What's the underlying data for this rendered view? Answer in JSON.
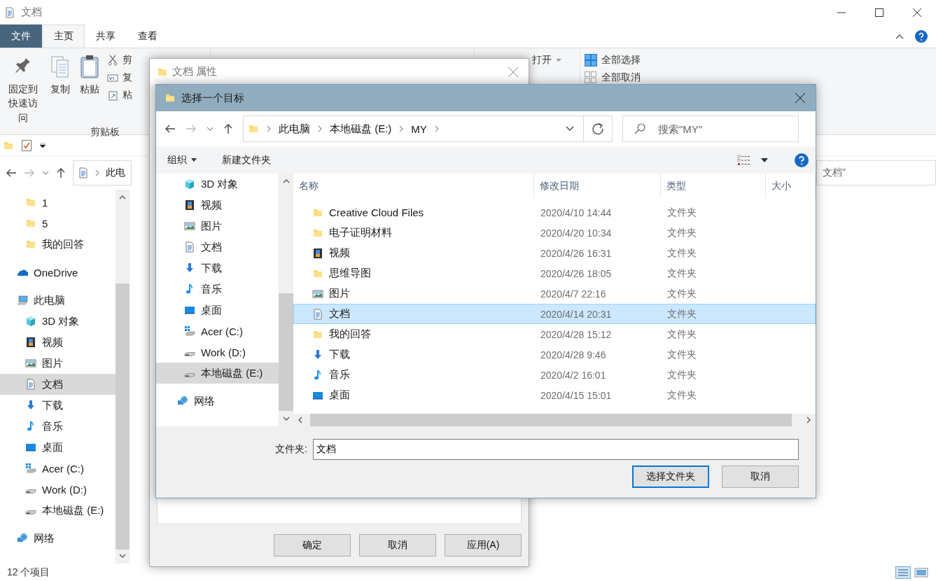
{
  "main_window": {
    "title": "文档",
    "ribbon_tabs": [
      {
        "label": "文件",
        "kind": "file"
      },
      {
        "label": "主页",
        "selected": true,
        "kind": "tab"
      },
      {
        "label": "共享",
        "selected": false,
        "kind": "tab"
      },
      {
        "label": "查看",
        "selected": false,
        "kind": "tab"
      }
    ],
    "clipboard_group": {
      "large_buttons": [
        {
          "label": "固定到快速访问",
          "kind": "pin"
        },
        {
          "label": "复制",
          "kind": "copy"
        },
        {
          "label": "粘贴",
          "kind": "paste"
        }
      ],
      "small_buttons": [
        {
          "label": "剪",
          "kind": "cut"
        },
        {
          "label": "复",
          "kind": "copypath"
        },
        {
          "label": "粘",
          "kind": "shortcut"
        }
      ],
      "label": "剪贴板"
    },
    "open_group": [
      {
        "label": "打开",
        "dropdown": true
      }
    ],
    "select_group": [
      {
        "label": "全部选择",
        "kind": "all"
      },
      {
        "label": "全部取消",
        "kind": "none"
      }
    ],
    "address_path": [
      "此电"
    ],
    "search_text": "文档\"",
    "nav_pane": {
      "quick_access_items": [
        {
          "label": "1",
          "kind": "folder",
          "selected": false
        },
        {
          "label": "5",
          "kind": "folder",
          "selected": false
        },
        {
          "label": "我的回答",
          "kind": "folder",
          "selected": false
        }
      ],
      "tree": [
        {
          "label": "OneDrive",
          "kind": "onedrive",
          "selected": false
        },
        {
          "label": "此电脑",
          "kind": "pc",
          "selected": false,
          "children": [
            {
              "label": "3D 对象",
              "kind": "cube",
              "selected": false
            },
            {
              "label": "视频",
              "kind": "video",
              "selected": false
            },
            {
              "label": "图片",
              "kind": "picture",
              "selected": false
            },
            {
              "label": "文档",
              "kind": "doc",
              "selected": true
            },
            {
              "label": "下载",
              "kind": "download",
              "selected": false
            },
            {
              "label": "音乐",
              "kind": "music",
              "selected": false
            },
            {
              "label": "桌面",
              "kind": "desktop",
              "selected": false
            },
            {
              "label": "Acer (C:)",
              "kind": "drive-win",
              "selected": false
            },
            {
              "label": "Work (D:)",
              "kind": "drive",
              "selected": false
            },
            {
              "label": "本地磁盘 (E:)",
              "kind": "drive",
              "selected": false
            }
          ]
        },
        {
          "label": "网络",
          "kind": "network",
          "selected": false
        }
      ]
    },
    "status_bar": "12 个项目"
  },
  "properties_dialog": {
    "title": "文档 属性",
    "buttons": [
      "确定",
      "取消",
      "应用(A)"
    ]
  },
  "select_dialog": {
    "title": "选择一个目标",
    "breadcrumbs": [
      "此电脑",
      "本地磁盘 (E:)",
      "MY"
    ],
    "search_placeholder": "搜索\"MY\"",
    "toolbar": [
      {
        "label": "组织",
        "dropdown": true
      },
      {
        "label": "新建文件夹",
        "dropdown": false
      }
    ],
    "nav_pane": {
      "pc_items": [
        {
          "label": "3D 对象",
          "kind": "cube",
          "selected": false
        },
        {
          "label": "视频",
          "kind": "video",
          "selected": false
        },
        {
          "label": "图片",
          "kind": "picture",
          "selected": false
        },
        {
          "label": "文档",
          "kind": "doc",
          "selected": false
        },
        {
          "label": "下载",
          "kind": "download",
          "selected": false
        },
        {
          "label": "音乐",
          "kind": "music",
          "selected": false
        },
        {
          "label": "桌面",
          "kind": "desktop",
          "selected": false
        },
        {
          "label": "Acer (C:)",
          "kind": "drive-win",
          "selected": false
        },
        {
          "label": "Work (D:)",
          "kind": "drive",
          "selected": false
        },
        {
          "label": "本地磁盘 (E:)",
          "kind": "drive",
          "selected": true
        }
      ],
      "tree": [
        {
          "label": "网络",
          "kind": "network",
          "selected": false
        }
      ]
    },
    "columns": [
      "名称",
      "修改日期",
      "类型",
      "大小"
    ],
    "rows": [
      {
        "name": "Creative Cloud Files",
        "kind": "folder",
        "modified": "2020/4/10 14:44",
        "type": "文件夹",
        "selected": false
      },
      {
        "name": "电子证明材料",
        "kind": "folder",
        "modified": "2020/4/20 10:34",
        "type": "文件夹",
        "selected": false
      },
      {
        "name": "视频",
        "kind": "video",
        "modified": "2020/4/26 16:31",
        "type": "文件夹",
        "selected": false
      },
      {
        "name": "思维导图",
        "kind": "folder",
        "modified": "2020/4/26 18:05",
        "type": "文件夹",
        "selected": false
      },
      {
        "name": "图片",
        "kind": "picture",
        "modified": "2020/4/7 22:16",
        "type": "文件夹",
        "selected": false
      },
      {
        "name": "文档",
        "kind": "doc",
        "modified": "2020/4/14 20:31",
        "type": "文件夹",
        "selected": true
      },
      {
        "name": "我的回答",
        "kind": "folder",
        "modified": "2020/4/28 15:12",
        "type": "文件夹",
        "selected": false
      },
      {
        "name": "下载",
        "kind": "download",
        "modified": "2020/4/28 9:46",
        "type": "文件夹",
        "selected": false
      },
      {
        "name": "音乐",
        "kind": "music",
        "modified": "2020/4/2 16:01",
        "type": "文件夹",
        "selected": false
      },
      {
        "name": "桌面",
        "kind": "desktop",
        "modified": "2020/4/15 15:01",
        "type": "文件夹",
        "selected": false
      }
    ],
    "folder_label": "文件夹:",
    "folder_value": "文档",
    "buttons": [
      {
        "label": "选择文件夹",
        "kind": "primary"
      },
      {
        "label": "取消",
        "kind": "normal"
      }
    ]
  }
}
